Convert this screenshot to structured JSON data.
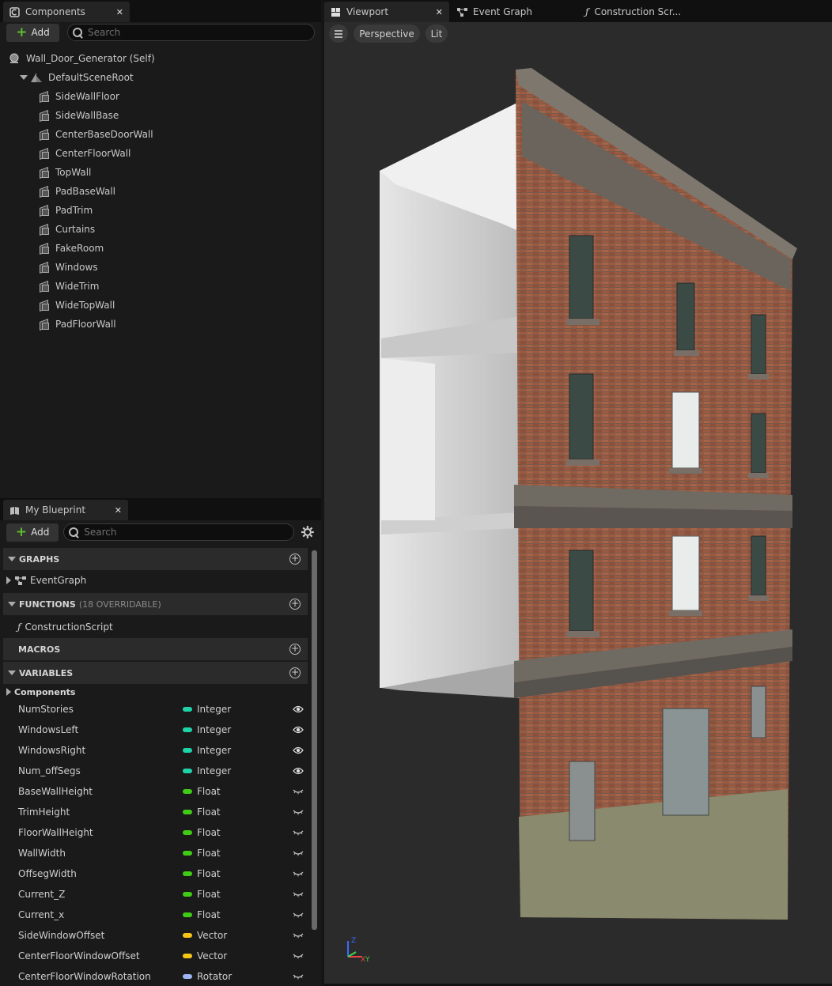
{
  "components_panel": {
    "tab_label": "Components",
    "add_label": "Add",
    "search_placeholder": "Search",
    "self_label": "Wall_Door_Generator (Self)",
    "root_label": "DefaultSceneRoot",
    "items": [
      "SideWallFloor",
      "SideWallBase",
      "CenterBaseDoorWall",
      "CenterFloorWall",
      "TopWall",
      "PadBaseWall",
      "PadTrim",
      "Curtains",
      "FakeRoom",
      "Windows",
      "WideTrim",
      "WideTopWall",
      "PadFloorWall"
    ]
  },
  "blueprint_panel": {
    "tab_label": "My Blueprint",
    "add_label": "Add",
    "search_placeholder": "Search",
    "graphs": {
      "header": "GRAPHS",
      "items": [
        "EventGraph"
      ]
    },
    "functions": {
      "header": "FUNCTIONS",
      "sub": "(18 OVERRIDABLE)",
      "items": [
        "ConstructionScript"
      ]
    },
    "macros": {
      "header": "MACROS"
    },
    "variables": {
      "header": "VARIABLES",
      "category": "Components",
      "items": [
        {
          "name": "NumStories",
          "type": "Integer",
          "color": "#1fd3a9",
          "visible": true
        },
        {
          "name": "WindowsLeft",
          "type": "Integer",
          "color": "#1fd3a9",
          "visible": true
        },
        {
          "name": "WindowsRight",
          "type": "Integer",
          "color": "#1fd3a9",
          "visible": true
        },
        {
          "name": "Num_offSegs",
          "type": "Integer",
          "color": "#1fd3a9",
          "visible": true
        },
        {
          "name": "BaseWallHeight",
          "type": "Float",
          "color": "#3fcb16",
          "visible": false
        },
        {
          "name": "TrimHeight",
          "type": "Float",
          "color": "#3fcb16",
          "visible": false
        },
        {
          "name": "FloorWallHeight",
          "type": "Float",
          "color": "#3fcb16",
          "visible": false
        },
        {
          "name": "WallWidth",
          "type": "Float",
          "color": "#3fcb16",
          "visible": false
        },
        {
          "name": "OffsegWidth",
          "type": "Float",
          "color": "#3fcb16",
          "visible": false
        },
        {
          "name": "Current_Z",
          "type": "Float",
          "color": "#3fcb16",
          "visible": false
        },
        {
          "name": "Current_x",
          "type": "Float",
          "color": "#3fcb16",
          "visible": false
        },
        {
          "name": "SideWindowOffset",
          "type": "Vector",
          "color": "#f5c518",
          "visible": false
        },
        {
          "name": "CenterFloorWindowOffset",
          "type": "Vector",
          "color": "#f5c518",
          "visible": false
        },
        {
          "name": "CenterFloorWindowRotation",
          "type": "Rotator",
          "color": "#a0b4f5",
          "visible": false
        }
      ]
    }
  },
  "editor_tabs": [
    {
      "label": "Viewport",
      "active": true
    },
    {
      "label": "Event Graph",
      "active": false
    },
    {
      "label": "Construction Scr...",
      "active": false
    }
  ],
  "viewport": {
    "view_mode": "Perspective",
    "lighting": "Lit",
    "axis_x": "X",
    "axis_y": "Y",
    "axis_z": "Z"
  },
  "colors": {
    "brick": "#9a5a42",
    "cornice": "#6f6a62",
    "interior": "#dcdcdc",
    "viewport_bg": "#2b2b2b"
  }
}
